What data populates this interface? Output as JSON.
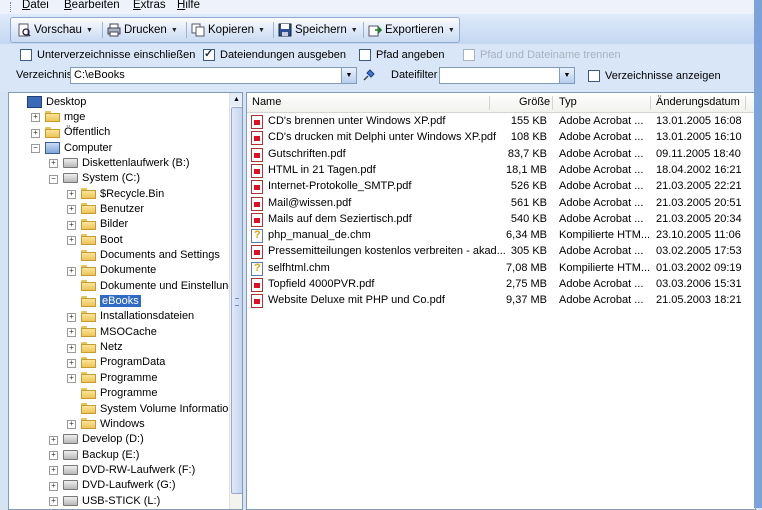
{
  "menu": [
    {
      "label": "Datei",
      "accel": "D",
      "rest": "atei"
    },
    {
      "label": "Bearbeiten",
      "accel": "B",
      "rest": "earbeiten"
    },
    {
      "label": "Extras",
      "accel": "E",
      "rest": "xtras"
    },
    {
      "label": "Hilfe",
      "accel": "H",
      "rest": "ilfe"
    }
  ],
  "toolbar": {
    "vorschau": "Vorschau",
    "drucken": "Drucken",
    "kopieren": "Kopieren",
    "speichern": "Speichern",
    "exportieren": "Exportieren"
  },
  "options": {
    "unterverzeichnisse": "Unterverzeichnisse einschließen",
    "unterverzeichnisse_checked": false,
    "dateiendungen": "Dateiendungen ausgeben",
    "dateiendungen_checked": true,
    "pfad": "Pfad angeben",
    "pfad_checked": false,
    "pfad_trennen": "Pfad und Dateiname trennen",
    "pfad_trennen_checked": false,
    "verzeichnis_label": "Verzeichnis",
    "verzeichnis_value": "C:\\eBooks",
    "dateifilter_label": "Dateifilter",
    "dateifilter_value": "",
    "verz_anzeigen": "Verzeichnisse anzeigen",
    "verz_anzeigen_checked": false
  },
  "tree": [
    {
      "label": "Desktop",
      "icon": "desktop-icon",
      "level": 0,
      "expander": ""
    },
    {
      "label": "mge",
      "icon": "user-folder-icon",
      "level": 1,
      "expander": "+"
    },
    {
      "label": "Öffentlich",
      "icon": "folder-icon",
      "level": 1,
      "expander": "+"
    },
    {
      "label": "Computer",
      "icon": "computer-icon",
      "level": 1,
      "expander": "−"
    },
    {
      "label": "Diskettenlaufwerk (B:)",
      "icon": "floppy-drive-icon",
      "level": 2,
      "expander": "+"
    },
    {
      "label": "System (C:)",
      "icon": "hard-drive-icon",
      "level": 2,
      "expander": "−"
    },
    {
      "label": "$Recycle.Bin",
      "icon": "folder-icon",
      "level": 3,
      "expander": "+"
    },
    {
      "label": "Benutzer",
      "icon": "folder-icon",
      "level": 3,
      "expander": "+"
    },
    {
      "label": "Bilder",
      "icon": "folder-icon",
      "level": 3,
      "expander": "+"
    },
    {
      "label": "Boot",
      "icon": "folder-icon",
      "level": 3,
      "expander": "+"
    },
    {
      "label": "Documents and Settings",
      "icon": "shortcut-folder-icon",
      "level": 3,
      "expander": ""
    },
    {
      "label": "Dokumente",
      "icon": "folder-icon",
      "level": 3,
      "expander": "+"
    },
    {
      "label": "Dokumente und Einstellungen",
      "icon": "shortcut-folder-icon",
      "level": 3,
      "expander": ""
    },
    {
      "label": "eBooks",
      "icon": "folder-icon",
      "level": 3,
      "expander": "",
      "selected": true
    },
    {
      "label": "Installationsdateien",
      "icon": "folder-icon",
      "level": 3,
      "expander": "+"
    },
    {
      "label": "MSOCache",
      "icon": "folder-icon",
      "level": 3,
      "expander": "+"
    },
    {
      "label": "Netz",
      "icon": "folder-icon",
      "level": 3,
      "expander": "+"
    },
    {
      "label": "ProgramData",
      "icon": "folder-icon",
      "level": 3,
      "expander": "+"
    },
    {
      "label": "Programme",
      "icon": "folder-icon",
      "level": 3,
      "expander": "+"
    },
    {
      "label": "Programme",
      "icon": "shortcut-folder-icon",
      "level": 3,
      "expander": ""
    },
    {
      "label": "System Volume Information",
      "icon": "folder-icon",
      "level": 3,
      "expander": ""
    },
    {
      "label": "Windows",
      "icon": "folder-icon",
      "level": 3,
      "expander": "+"
    },
    {
      "label": "Develop (D:)",
      "icon": "hard-drive-icon",
      "level": 2,
      "expander": "+"
    },
    {
      "label": "Backup (E:)",
      "icon": "hard-drive-icon",
      "level": 2,
      "expander": "+"
    },
    {
      "label": "DVD-RW-Laufwerk (F:)",
      "icon": "dvd-drive-icon",
      "level": 2,
      "expander": "+"
    },
    {
      "label": "DVD-Laufwerk (G:)",
      "icon": "dvd-drive-icon",
      "level": 2,
      "expander": "+"
    },
    {
      "label": "USB-STICK (L:)",
      "icon": "usb-drive-icon",
      "level": 2,
      "expander": "+"
    }
  ],
  "columns": [
    "Name",
    "Größe",
    "Typ",
    "Änderungsdatum"
  ],
  "files": [
    {
      "name": "CD's brennen unter Windows XP.pdf",
      "size": "155 KB",
      "type": "Adobe Acrobat ...",
      "date": "13.01.2005 16:08",
      "icon": "pdf"
    },
    {
      "name": "CD's drucken mit Delphi unter Windows XP.pdf",
      "size": "108 KB",
      "type": "Adobe Acrobat ...",
      "date": "13.01.2005 16:10",
      "icon": "pdf"
    },
    {
      "name": "Gutschriften.pdf",
      "size": "83,7 KB",
      "type": "Adobe Acrobat ...",
      "date": "09.11.2005 18:40",
      "icon": "pdf"
    },
    {
      "name": "HTML in 21 Tagen.pdf",
      "size": "18,1 MB",
      "type": "Adobe Acrobat ...",
      "date": "18.04.2002 16:21",
      "icon": "pdf"
    },
    {
      "name": "Internet-Protokolle_SMTP.pdf",
      "size": "526 KB",
      "type": "Adobe Acrobat ...",
      "date": "21.03.2005 22:21",
      "icon": "pdf"
    },
    {
      "name": "Mail@wissen.pdf",
      "size": "561 KB",
      "type": "Adobe Acrobat ...",
      "date": "21.03.2005 20:51",
      "icon": "pdf"
    },
    {
      "name": "Mails auf dem Seziertisch.pdf",
      "size": "540 KB",
      "type": "Adobe Acrobat ...",
      "date": "21.03.2005 20:34",
      "icon": "pdf"
    },
    {
      "name": "php_manual_de.chm",
      "size": "6,34 MB",
      "type": "Kompilierte HTM...",
      "date": "23.10.2005 11:06",
      "icon": "chm"
    },
    {
      "name": "Pressemitteilungen kostenlos verbreiten - akad...",
      "size": "305 KB",
      "type": "Adobe Acrobat ...",
      "date": "03.02.2005 17:53",
      "icon": "pdf"
    },
    {
      "name": "selfhtml.chm",
      "size": "7,08 MB",
      "type": "Kompilierte HTM...",
      "date": "01.03.2002 09:19",
      "icon": "chm"
    },
    {
      "name": "Topfield 4000PVR.pdf",
      "size": "2,75 MB",
      "type": "Adobe Acrobat ...",
      "date": "03.03.2006 15:31",
      "icon": "pdf"
    },
    {
      "name": "Website Deluxe mit PHP und Co.pdf",
      "size": "9,37 MB",
      "type": "Adobe Acrobat ...",
      "date": "21.05.2003 18:21",
      "icon": "pdf"
    }
  ]
}
